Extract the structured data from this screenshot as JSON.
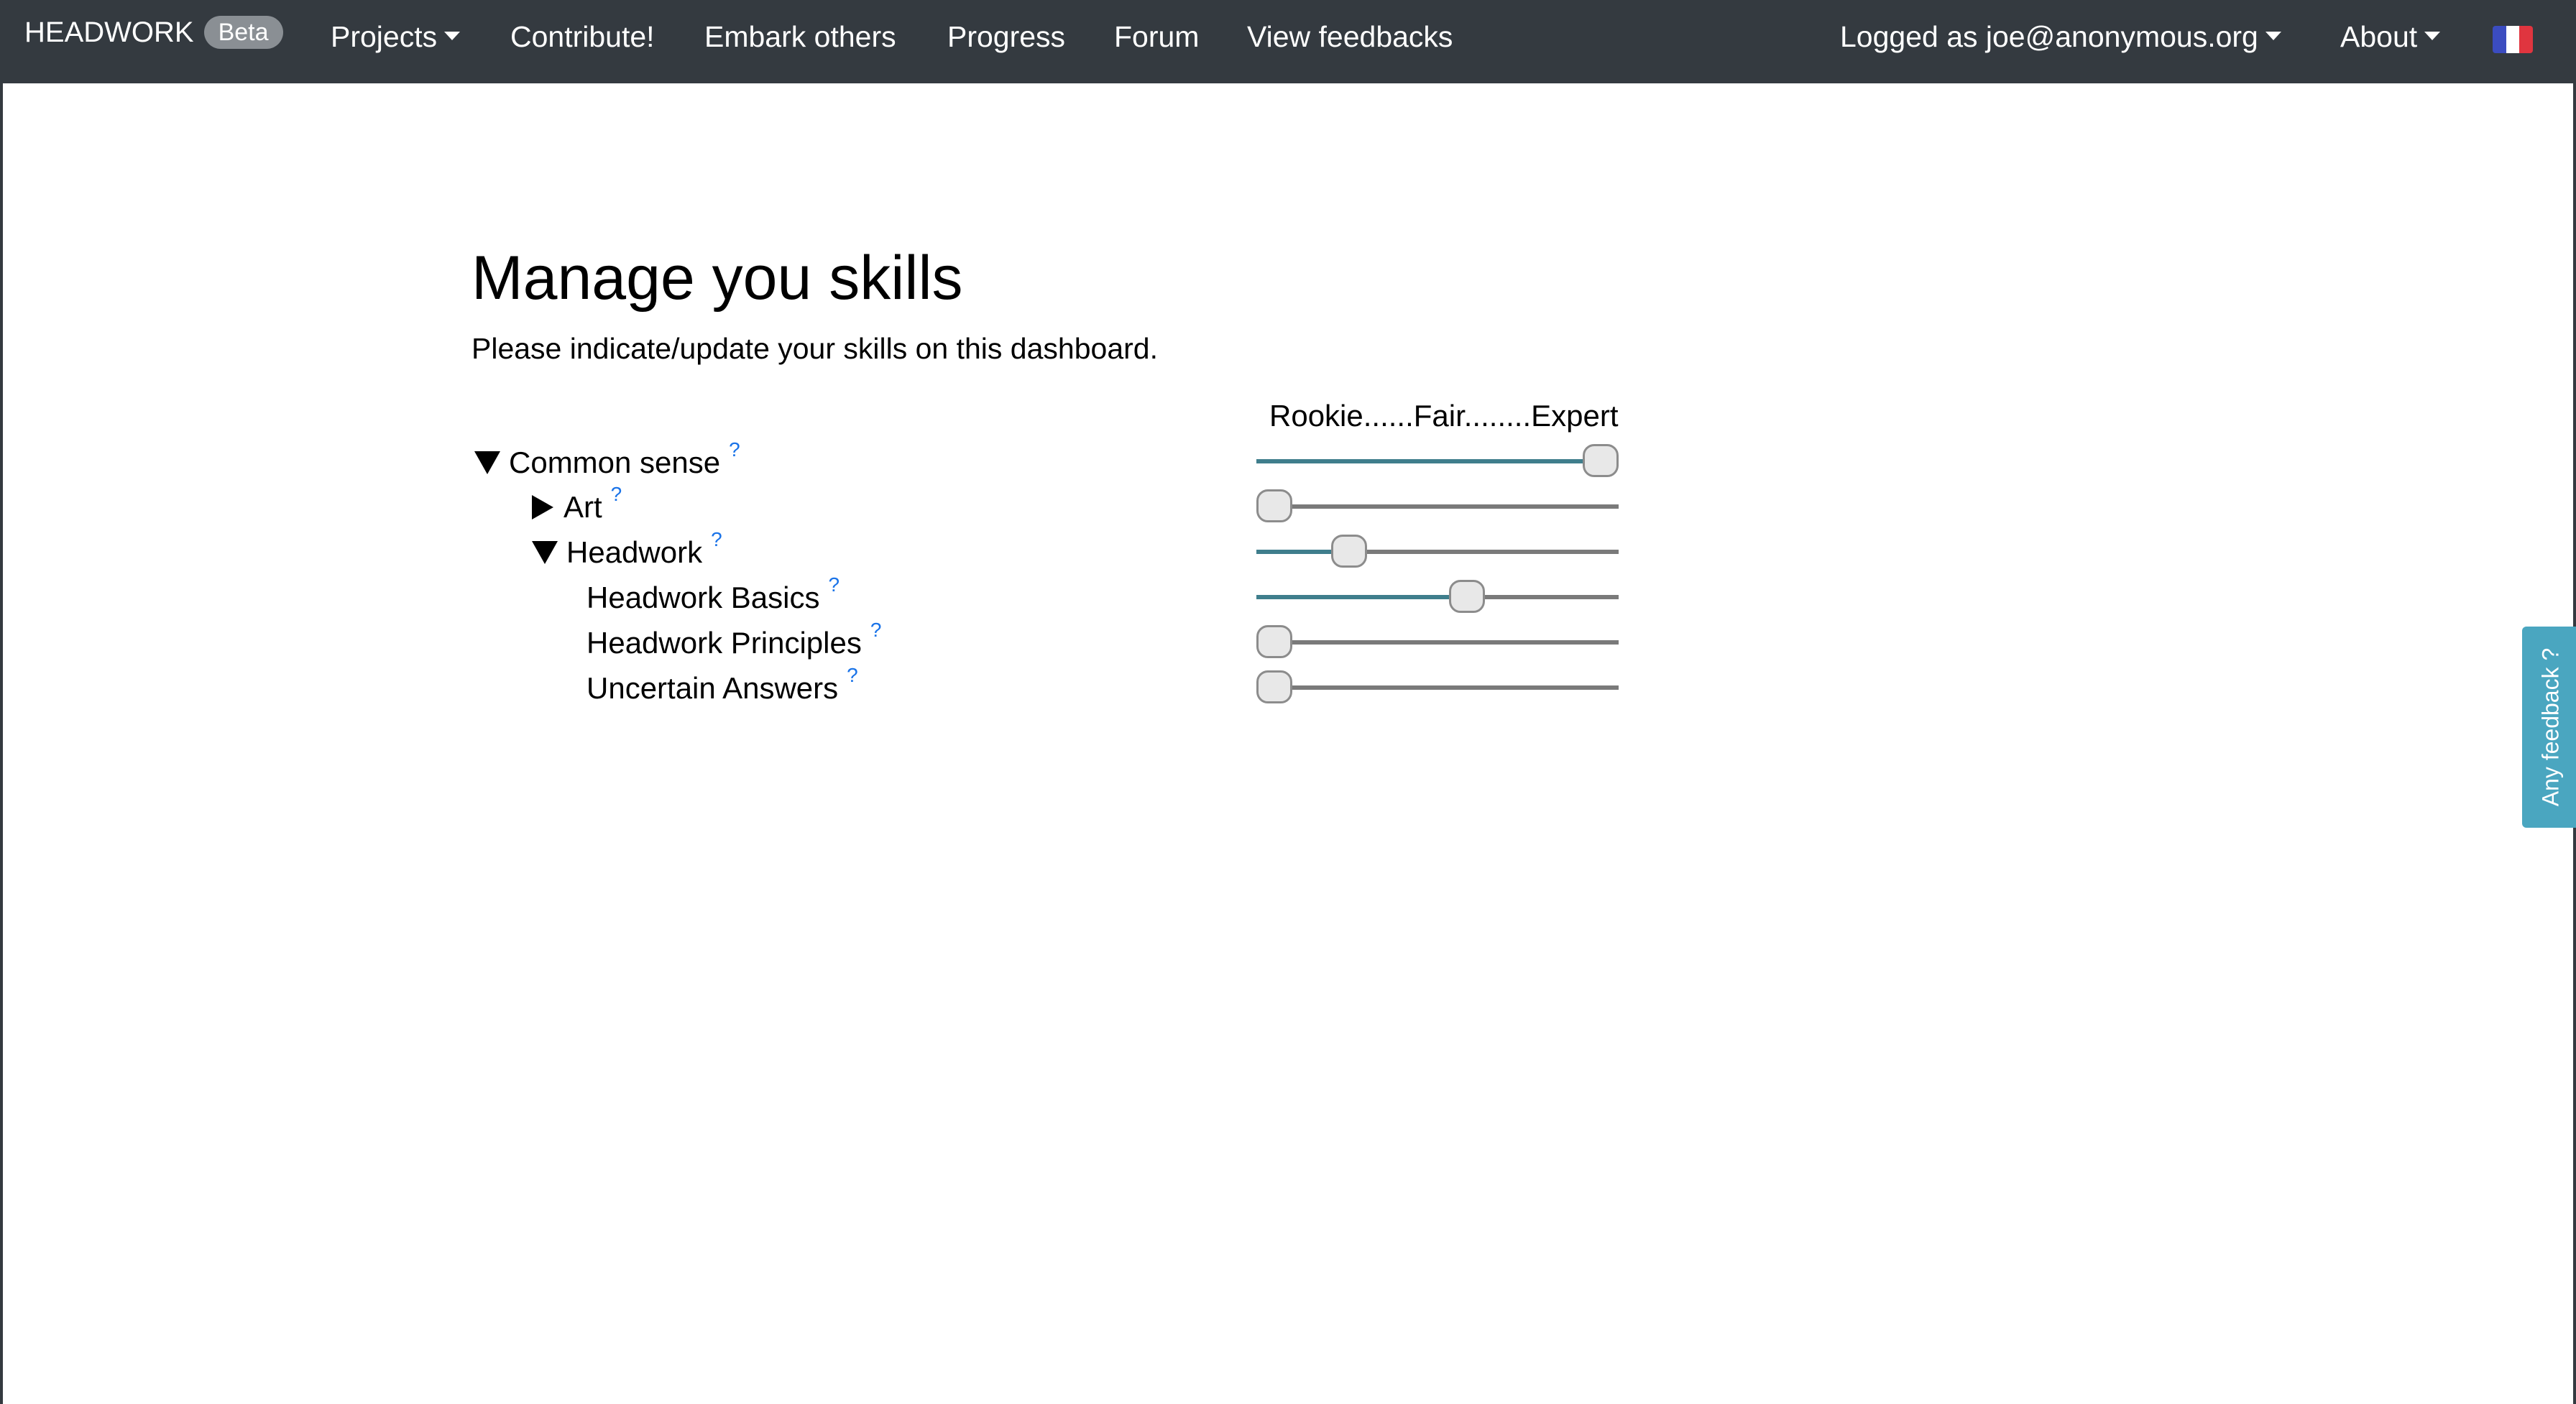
{
  "navbar": {
    "brand": "HEADWORK",
    "badge": "Beta",
    "items": [
      {
        "label": "Projects",
        "dropdown": true
      },
      {
        "label": "Contribute!",
        "dropdown": false
      },
      {
        "label": "Embark others",
        "dropdown": false
      },
      {
        "label": "Progress",
        "dropdown": false
      },
      {
        "label": "Forum",
        "dropdown": false
      },
      {
        "label": "View feedbacks",
        "dropdown": false
      }
    ],
    "user_menu": "Logged as joe@anonymous.org",
    "about_menu": "About",
    "language_flag": "flag-fr-icon"
  },
  "page": {
    "title": "Manage you skills",
    "subtitle": "Please indicate/update your skills on this dashboard.",
    "scale_label": "Rookie......Fair........Expert"
  },
  "skills": [
    {
      "label": "Common sense",
      "help": "?",
      "expanded": true,
      "toggle": "triangle-down-icon",
      "level": 1.0
    },
    {
      "label": "Art",
      "help": "?",
      "expanded": false,
      "toggle": "triangle-right-icon",
      "level": 0.0
    },
    {
      "label": "Headwork",
      "help": "?",
      "expanded": true,
      "toggle": "triangle-down-icon",
      "level": 0.23
    },
    {
      "label": "Headwork Basics",
      "help": "?",
      "level": 0.59
    },
    {
      "label": "Headwork Principles",
      "help": "?",
      "level": 0.0
    },
    {
      "label": "Uncertain Answers",
      "help": "?",
      "level": 0.0
    }
  ],
  "feedback_tab": "Any feedback ?",
  "colors": {
    "navbar_bg": "#343a40",
    "slider_fill": "#3f7e8c",
    "help_link": "#1a73e8",
    "feedback_tab": "#4aa6c0"
  }
}
